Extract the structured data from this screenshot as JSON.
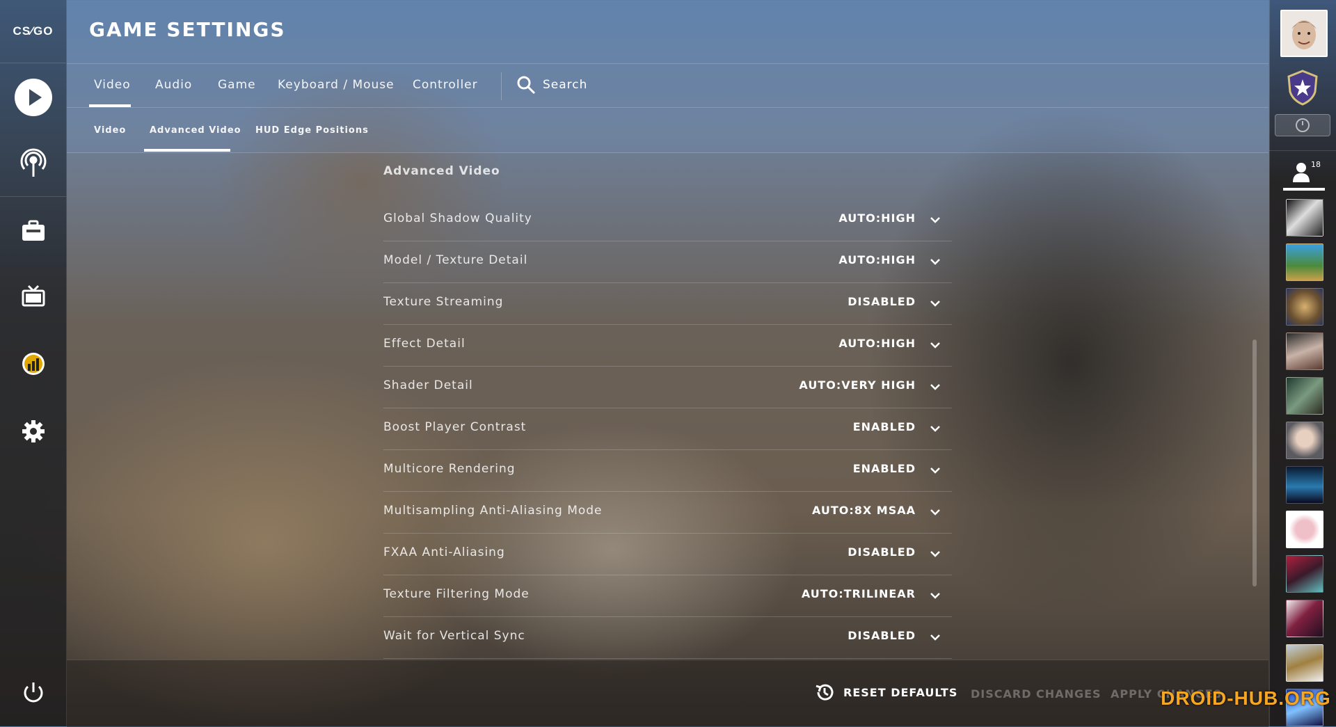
{
  "app": {
    "logo_text": "CS⁄GO"
  },
  "header": {
    "title": "GAME SETTINGS"
  },
  "tabs": [
    {
      "label": "Video",
      "active": true
    },
    {
      "label": "Audio",
      "active": false
    },
    {
      "label": "Game",
      "active": false
    },
    {
      "label": "Keyboard / Mouse",
      "active": false
    },
    {
      "label": "Controller",
      "active": false
    }
  ],
  "search": {
    "label": "Search",
    "icon": "search-icon"
  },
  "subtabs": [
    {
      "label": "Video",
      "active": false
    },
    {
      "label": "Advanced Video",
      "active": true
    },
    {
      "label": "HUD Edge Positions",
      "active": false
    }
  ],
  "section": {
    "title": "Advanced Video"
  },
  "settings": [
    {
      "label": "Global Shadow Quality",
      "value": "AUTO:HIGH"
    },
    {
      "label": "Model / Texture Detail",
      "value": "AUTO:HIGH"
    },
    {
      "label": "Texture Streaming",
      "value": "DISABLED"
    },
    {
      "label": "Effect Detail",
      "value": "AUTO:HIGH"
    },
    {
      "label": "Shader Detail",
      "value": "AUTO:VERY HIGH"
    },
    {
      "label": "Boost Player Contrast",
      "value": "ENABLED"
    },
    {
      "label": "Multicore Rendering",
      "value": "ENABLED"
    },
    {
      "label": "Multisampling Anti-Aliasing Mode",
      "value": "AUTO:8X MSAA"
    },
    {
      "label": "FXAA Anti-Aliasing",
      "value": "DISABLED"
    },
    {
      "label": "Texture Filtering Mode",
      "value": "AUTO:TRILINEAR"
    },
    {
      "label": "Wait for Vertical Sync",
      "value": "DISABLED"
    }
  ],
  "footer": {
    "reset_label": "RESET DEFAULTS",
    "discard_label": "DISCARD CHANGES",
    "apply_label": "APPLY CHANGES"
  },
  "left_nav": [
    "play-icon",
    "broadcast-icon",
    "inventory-icon",
    "watch-tv-icon",
    "stats-icon",
    "gear-icon",
    "power-icon"
  ],
  "friends": {
    "count": "18"
  },
  "watermark": "DROID-HUB.ORG",
  "colors": {
    "accent": "#ffffff",
    "watermark": "#f5a623"
  }
}
